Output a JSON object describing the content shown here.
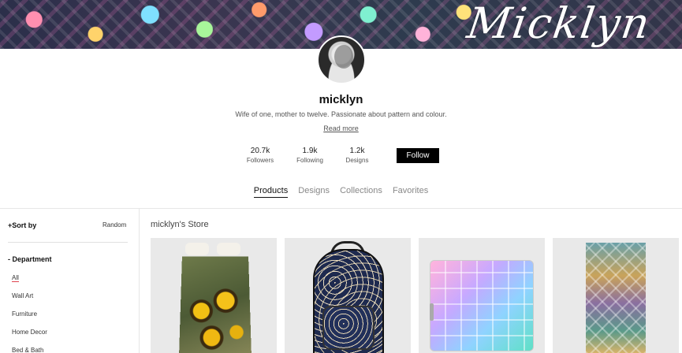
{
  "banner": {
    "signature": "Micklyn"
  },
  "profile": {
    "username": "micklyn",
    "bio": "Wife of one, mother to twelve. Passionate about pattern and colour.",
    "read_more": "Read more",
    "stats": [
      {
        "value": "20.7k",
        "label": "Followers"
      },
      {
        "value": "1.9k",
        "label": "Following"
      },
      {
        "value": "1.2k",
        "label": "Designs"
      }
    ],
    "follow_label": "Follow"
  },
  "tabs": [
    {
      "label": "Products",
      "active": true
    },
    {
      "label": "Designs",
      "active": false
    },
    {
      "label": "Collections",
      "active": false
    },
    {
      "label": "Favorites",
      "active": false
    }
  ],
  "sidebar": {
    "sort_label": "+Sort by",
    "sort_value": "Random",
    "department_label": "- Department",
    "departments": [
      "All",
      "Wall Art",
      "Furniture",
      "Home Decor",
      "Bed & Bath"
    ]
  },
  "store": {
    "title": "micklyn's Store",
    "products": [
      {
        "icon": "duvet-cover"
      },
      {
        "icon": "backpack"
      },
      {
        "icon": "laptop-skin"
      },
      {
        "icon": "bath-towel"
      }
    ]
  },
  "colors": {
    "accent": "#000000",
    "active_underline": "#e0444f"
  }
}
